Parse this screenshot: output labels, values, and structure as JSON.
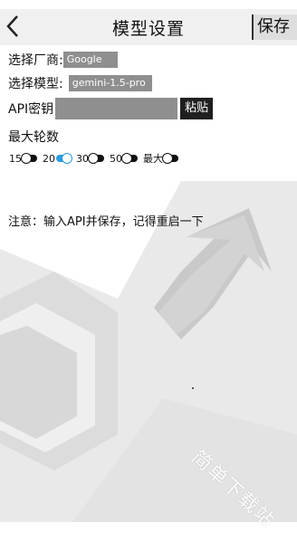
{
  "header": {
    "back_icon": "chevron-left-icon",
    "title": "模型设置",
    "save_label": "保存"
  },
  "vendor": {
    "label": "选择厂商:",
    "value": "Google"
  },
  "model": {
    "label": "选择模型:",
    "value": "gemini-1.5-pro"
  },
  "api_key": {
    "label": "API密钥",
    "value": "",
    "paste_label": "粘贴"
  },
  "max_turns": {
    "label": "最大轮数",
    "options": [
      {
        "label": "15",
        "on": false
      },
      {
        "label": "20",
        "on": true
      },
      {
        "label": "30",
        "on": false
      },
      {
        "label": "50",
        "on": false
      },
      {
        "label": "最大",
        "on": false
      }
    ]
  },
  "notice": "注意：输入API并保存，记得重启一下",
  "watermark": "简单下载站",
  "colors": {
    "toggle_on": "#2a9be0",
    "field_bg": "#8f8f8f",
    "header_bg": "#f0f0f0"
  }
}
